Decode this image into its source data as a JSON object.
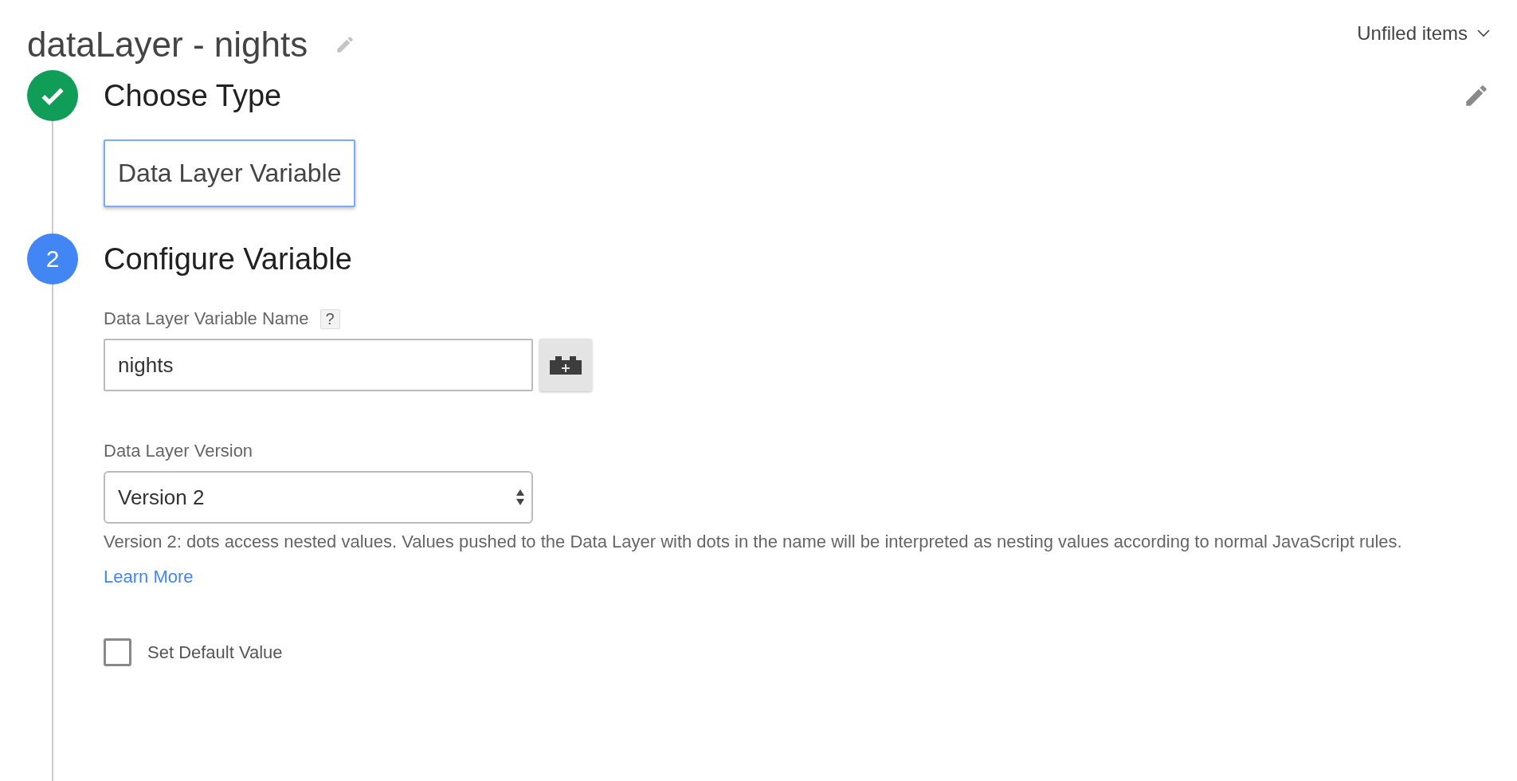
{
  "title": "dataLayer - nights",
  "folder": "Unfiled items",
  "steps": [
    {
      "completed": true,
      "title": "Choose Type",
      "selected_type": "Data Layer Variable"
    },
    {
      "completed": false,
      "number": "2",
      "title": "Configure Variable",
      "variable_name": {
        "label": "Data Layer Variable Name",
        "help": "?",
        "value": "nights"
      },
      "version": {
        "label": "Data Layer Version",
        "value": "Version 2",
        "description": "Version 2: dots access nested values. Values pushed to the Data Layer with dots in the name will be interpreted as nesting values according to normal JavaScript rules.",
        "link": "Learn More"
      },
      "default_value": {
        "label": "Set Default Value",
        "checked": false
      }
    }
  ]
}
